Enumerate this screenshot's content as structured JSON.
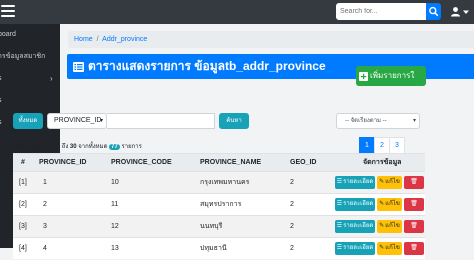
{
  "navbar": {
    "search_placeholder": "Search for...",
    "search_icon": "search-icon",
    "user_icon": "user-icon",
    "caret_icon": "caret-down-icon"
  },
  "sidebar": {
    "items": [
      {
        "label": "board"
      },
      {
        "label": "ารข้อมูลสมาชิก"
      },
      {
        "label": "s",
        "has_chevron": true
      },
      {
        "label": "s"
      },
      {
        "label": "s"
      }
    ]
  },
  "breadcrumb": {
    "home": "Home",
    "separator": "/",
    "current": "Addr_province"
  },
  "page": {
    "title": "ตารางแสดงรายการ ข้อมูลtb_addr_province",
    "title_icon": "list-icon",
    "add_button": "เพิ่มรายการใ"
  },
  "filters": {
    "field_label": "ทั้งหมด",
    "field_value": "PROVINCE_ID",
    "keyword_value": "",
    "search_button": "ค้นหา",
    "province_select": "-- จัดเรียงตาม --"
  },
  "summary": {
    "prefix": "แสดงรายการที่",
    "from": "1",
    "to_label": "ถึง",
    "to": "30",
    "of_label": "จากทั้งหมด",
    "total": "77",
    "suffix": "รายการ"
  },
  "pagination": [
    "1",
    "2",
    "3"
  ],
  "table": {
    "columns": [
      "#",
      "PROVINCE_ID",
      "PROVINCE_CODE",
      "PROVINCE_NAME",
      "GEO_ID",
      "จัดการข้อมูล"
    ],
    "rows": [
      {
        "no": "[1]",
        "province_id": "1",
        "province_code": "10",
        "province_name": "กรุงเทพมหานคร",
        "geo_id": "2"
      },
      {
        "no": "[2]",
        "province_id": "2",
        "province_code": "11",
        "province_name": "สมุทรปราการ",
        "geo_id": "2"
      },
      {
        "no": "[3]",
        "province_id": "3",
        "province_code": "12",
        "province_name": "นนทบุรี",
        "geo_id": "2"
      },
      {
        "no": "[4]",
        "province_id": "4",
        "province_code": "13",
        "province_name": "ปทุมธานี",
        "geo_id": "2"
      }
    ],
    "actions": {
      "detail": "รายละเอียด",
      "edit": "แก้ไข",
      "delete": "ลบ"
    }
  },
  "colors": {
    "navbar": "#343a40",
    "sidebar": "#212529",
    "primary": "#007bff",
    "success": "#28a745",
    "info": "#17a2b8",
    "warning": "#ffc107",
    "danger": "#dc3545"
  }
}
